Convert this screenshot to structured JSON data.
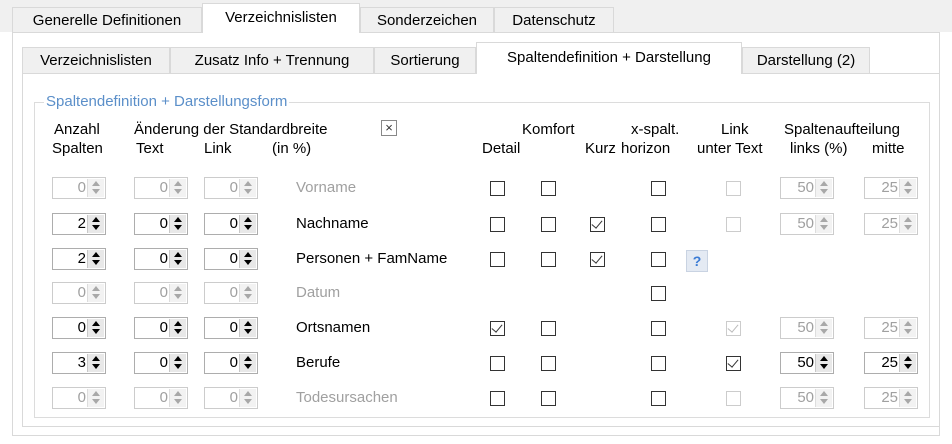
{
  "outer_tabs": [
    "Generelle Definitionen",
    "Verzeichnislisten",
    "Sonderzeichen",
    "Datenschutz"
  ],
  "inner_tabs": [
    "Verzeichnislisten",
    "Zusatz Info + Trennung",
    "Sortierung",
    "Spaltendefinition + Darstellung",
    "Darstellung (2)"
  ],
  "group_title": "Spaltendefinition + Darstellungsform",
  "headers": {
    "anzahl": "Anzahl",
    "spalten": "Spalten",
    "aenderung": "Änderung der Standardbreite",
    "text": "Text",
    "link": "Link",
    "in_pct": "(in %)",
    "reset_icon_label": "×",
    "komfort": "Komfort",
    "detail": "Detail",
    "kurz": "Kurz",
    "x_spalt": "x-spalt.",
    "horizon": "horizon",
    "link_unter": "Link",
    "unter_text": "unter Text",
    "spaltenaufteilung": "Spaltenaufteilung",
    "links_pct": "links  (%)",
    "mitte": "mitte"
  },
  "help_label": "?",
  "rows": [
    {
      "anzahl": "0",
      "text": "0",
      "link": "0",
      "name": "Vorname",
      "enabled": false,
      "detail": false,
      "komfort": false,
      "kurz": null,
      "xspalt": false,
      "link_unter": false,
      "link_unter_enabled": false,
      "links": "50",
      "mitte": "25",
      "split_enabled": false
    },
    {
      "anzahl": "2",
      "text": "0",
      "link": "0",
      "name": "Nachname",
      "enabled": true,
      "detail": false,
      "komfort": false,
      "kurz": true,
      "xspalt": false,
      "link_unter": false,
      "link_unter_enabled": false,
      "links": "50",
      "mitte": "25",
      "split_enabled": false
    },
    {
      "anzahl": "2",
      "text": "0",
      "link": "0",
      "name": "Personen + FamName",
      "enabled": true,
      "detail": false,
      "komfort": false,
      "kurz": true,
      "xspalt": false,
      "link_unter": null,
      "link_unter_enabled": false,
      "links": null,
      "mitte": null,
      "split_enabled": false
    },
    {
      "anzahl": "0",
      "text": "0",
      "link": "0",
      "name": "Datum",
      "enabled": false,
      "detail": null,
      "komfort": null,
      "kurz": null,
      "xspalt": false,
      "link_unter": null,
      "link_unter_enabled": false,
      "links": null,
      "mitte": null,
      "split_enabled": false
    },
    {
      "anzahl": "0",
      "text": "0",
      "link": "0",
      "name": "Ortsnamen",
      "enabled": true,
      "detail": true,
      "komfort": false,
      "kurz": null,
      "xspalt": false,
      "link_unter": true,
      "link_unter_enabled": false,
      "links": "50",
      "mitte": "25",
      "split_enabled": false
    },
    {
      "anzahl": "3",
      "text": "0",
      "link": "0",
      "name": "Berufe",
      "enabled": true,
      "detail": false,
      "komfort": false,
      "kurz": null,
      "xspalt": false,
      "link_unter": true,
      "link_unter_enabled": true,
      "links": "50",
      "mitte": "25",
      "split_enabled": true
    },
    {
      "anzahl": "0",
      "text": "0",
      "link": "0",
      "name": "Todesursachen",
      "enabled": false,
      "detail": false,
      "komfort": false,
      "kurz": null,
      "xspalt": false,
      "link_unter": false,
      "link_unter_enabled": false,
      "links": "50",
      "mitte": "25",
      "split_enabled": false
    }
  ]
}
